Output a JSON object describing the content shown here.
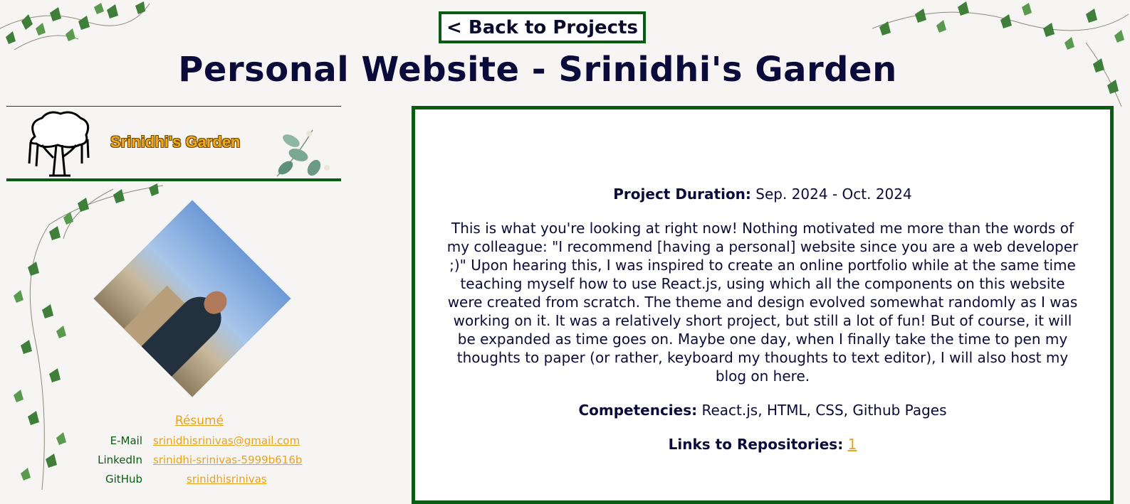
{
  "nav": {
    "back_label": "< Back to Projects"
  },
  "page": {
    "title": "Personal Website - Srinidhi's Garden"
  },
  "sidebar": {
    "site_name": "Srinidhi's Garden",
    "resume_label": "Résumé",
    "contacts": [
      {
        "label": "E-Mail",
        "value": "srinidhisrinivas@gmail.com"
      },
      {
        "label": "LinkedIn",
        "value": "srinidhi-srinivas-5999b616b"
      },
      {
        "label": "GitHub",
        "value": "srinidhisrinivas"
      }
    ]
  },
  "project": {
    "duration_label": "Project Duration:",
    "duration_value": "Sep. 2024 - Oct. 2024",
    "description": "This is what you're looking at right now! Nothing motivated me more than the words of my colleague: \"I recommend [having a personal] website since you are a web developer ;)\" Upon hearing this, I was inspired to create an online portfolio while at the same time teaching myself how to use React.js, using which all the components on this website were created from scratch. The theme and design evolved somewhat randomly as I was working on it. It was a relatively short project, but still a lot of fun! But of course, it will be expanded as time goes on. Maybe one day, when I finally take the time to pen my thoughts to paper (or rather, keyboard my thoughts to text editor), I will also host my blog on here.",
    "competencies_label": "Competencies:",
    "competencies_value": "React.js, HTML, CSS, Github Pages",
    "links_label": "Links to Repositories:",
    "links": [
      "1"
    ]
  },
  "colors": {
    "accent": "#e9a21c",
    "border": "#0a5c12",
    "title": "#0b0b3b"
  },
  "icons": [
    "tree-logo-icon",
    "eucalyptus-icon",
    "ivy-vine-icon"
  ]
}
